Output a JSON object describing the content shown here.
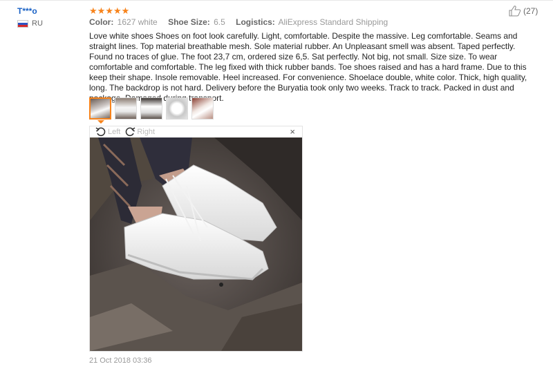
{
  "review": {
    "user": {
      "name": "T***o",
      "country": "RU"
    },
    "rating": 5,
    "meta": {
      "color_label": "Color:",
      "color_value": "1627 white",
      "size_label": "Shoe Size:",
      "size_value": "6.5",
      "logistics_label": "Logistics:",
      "logistics_value": "AliExpress Standard Shipping"
    },
    "helpful_count": "(27)",
    "text": "Love white shoes Shoes on foot look carefully. Light, comfortable. Despite the massive. Leg comfortable. Seams and straight lines. Top material breathable mesh. Sole material rubber. An Unpleasant smell was absent. Taped perfectly. Found no traces of glue. The foot 23,7 cm, ordered size 6,5. Sat perfectly. Not big, not small. Size size. To wear comfortable and comfortable. The leg fixed with thick rubber bands. Toe shoes raised and has a hard frame. Due to this keep their shape. Insole removable. Heel increased. For convenience. Shoelace double, white color. Thick, high quality, long. The backdrop is not hard. Delivery before the Buryatia took only two weeks. Track to track. Packed in dust and package. Damaged during transport.",
    "date": "21 Oct 2018 03:36",
    "thumbnails": [
      "photo 1",
      "photo 2",
      "photo 3",
      "photo 4",
      "photo 5"
    ],
    "viewer": {
      "rotate_left": "Left",
      "rotate_right": "Right",
      "close": "×"
    }
  },
  "colors": {
    "accent": "#f7831b",
    "link": "#1a62c5",
    "meta": "#999999"
  },
  "icons": {
    "helpful": "thumbs-up-icon",
    "rotate_left": "rotate-left-icon",
    "rotate_right": "rotate-right-icon",
    "close": "close-icon",
    "star": "star-icon",
    "flag": "flag-ru-icon"
  }
}
